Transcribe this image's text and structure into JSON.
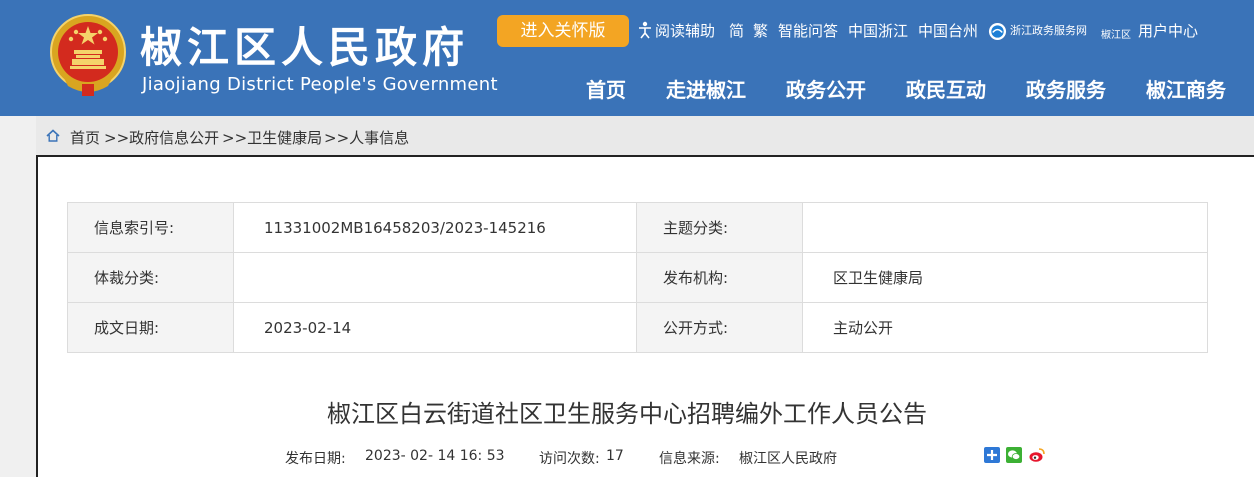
{
  "header": {
    "title": "椒江区人民政府",
    "subtitle": "Jiaojiang District People's Government",
    "care_mode_button": "进入关怀版",
    "top_links": {
      "reading_aid": "阅读辅助",
      "simplified": "简",
      "traditional": "繁",
      "smart_qa": "智能问答",
      "china_zhejiang": "中国浙江",
      "china_taizhou": "中国台州",
      "gov_service_net": "浙江政务服务网",
      "gov_service_region": "椒江区",
      "user_center": "用户中心"
    },
    "nav": [
      "首页",
      "走进椒江",
      "政务公开",
      "政民互动",
      "政务服务",
      "椒江商务"
    ]
  },
  "breadcrumb": {
    "items": [
      "首页",
      ">>政府信息公开",
      ">>卫生健康局",
      ">>人事信息"
    ]
  },
  "meta": {
    "index_no_label": "信息索引号:",
    "index_no_value": "11331002MB16458203/2023-145216",
    "topic_label": "主题分类:",
    "topic_value": "",
    "genre_label": "体裁分类:",
    "genre_value": "",
    "publisher_label": "发布机构:",
    "publisher_value": "区卫生健康局",
    "date_label": "成文日期:",
    "date_value": "2023-02-14",
    "open_mode_label": "公开方式:",
    "open_mode_value": "主动公开"
  },
  "article": {
    "title": "椒江区白云街道社区卫生服务中心招聘编外工作人员公告",
    "publish_label": "发布日期:",
    "publish_value": "2023- 02- 14 16: 53",
    "visits_label": "访问次数:",
    "visits_value": "17",
    "source_label": "信息来源:",
    "source_value": "椒江区人民政府"
  },
  "icons": {
    "share": [
      "share-plus-icon",
      "wechat-icon",
      "weibo-icon"
    ]
  },
  "colors": {
    "header_bg": "#3a73b8",
    "care_button": "#f3a523"
  }
}
